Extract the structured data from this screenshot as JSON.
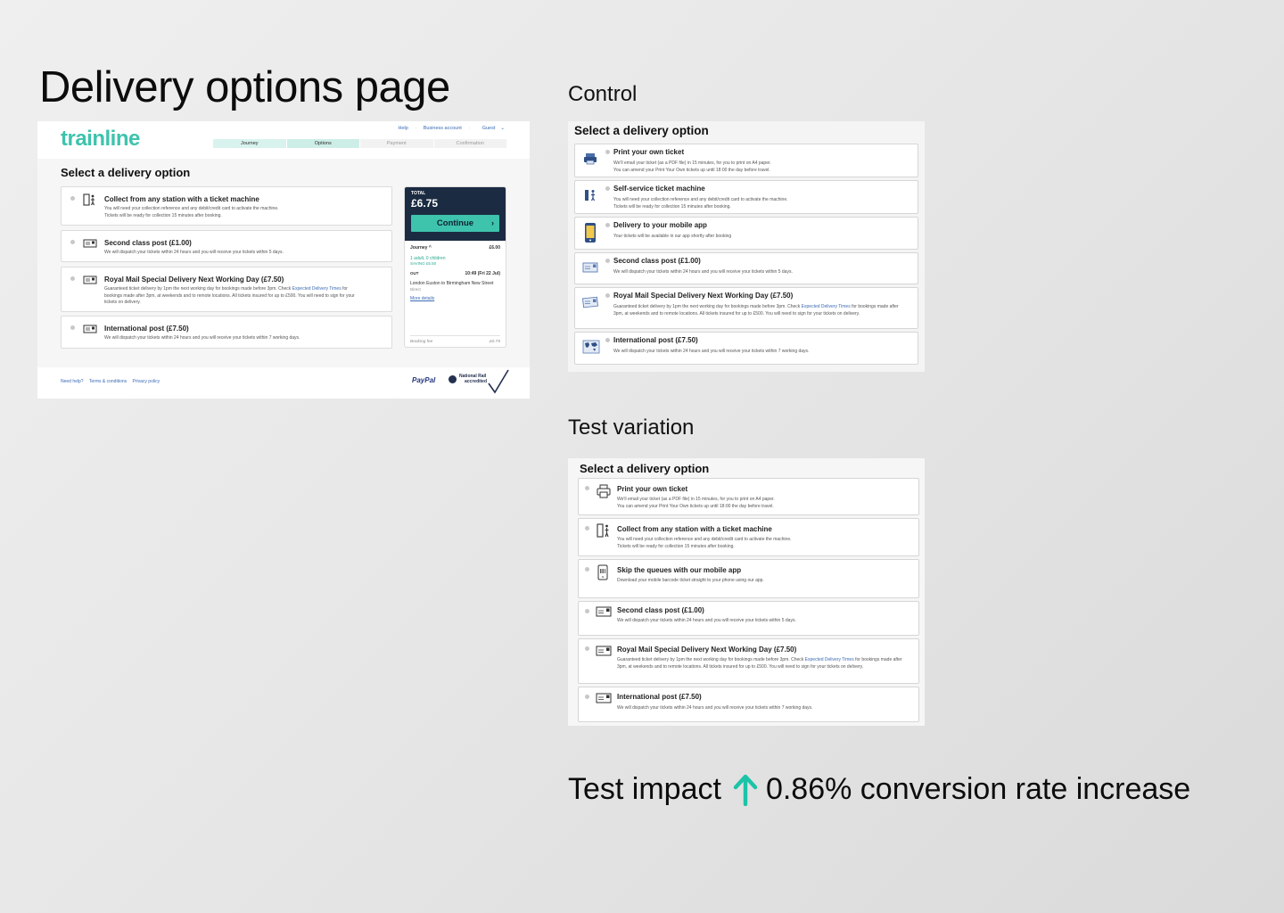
{
  "page_title": "Delivery options page",
  "main_screenshot": {
    "logo": "trainline",
    "top_links": [
      "Help",
      "Business account",
      "Guest"
    ],
    "steps": [
      "Journey",
      "Options",
      "Payment",
      "Confirmation"
    ],
    "heading": "Select a delivery option",
    "options": [
      {
        "title": "Collect from any station with a ticket machine",
        "desc": "You will need your collection reference and any debit/credit card to activate the machine.",
        "desc2": "Tickets will be ready for collection 15 minutes after booking."
      },
      {
        "title": "Second class post (£1.00)",
        "desc": "We will dispatch your tickets within 24 hours and you will receive your tickets within 5 days."
      },
      {
        "title": "Royal Mail Special Delivery Next Working Day (£7.50)",
        "desc_a": "Guaranteed ticket delivery by 1pm the next working day for bookings made before 3pm. Check ",
        "desc_link": "Expected Delivery Times",
        "desc_b": " for bookings made after 3pm, at weekends and to remote locations. All tickets insured for up to £500. You will need to sign for your tickets on delivery."
      },
      {
        "title": "International post (£7.50)",
        "desc": "We will dispatch your tickets within 24 hours and you will receive your tickets within 7 working days."
      }
    ],
    "summary": {
      "total_label": "TOTAL",
      "total": "£6.75",
      "continue": "Continue",
      "journey_label": "Journey",
      "journey_price": "£6.00",
      "passengers": "1 adult, 0 children",
      "saving": "SAVING £5.50",
      "out_label": "OUT",
      "out_time": "10:49 (Fri 22 Jul)",
      "route": "London Euston to Birmingham New Street",
      "direct": "Direct",
      "more_details": "More details",
      "booking_fee_label": "Booking fee",
      "booking_fee": "£0.75"
    },
    "footer_links": [
      "Need help?",
      "Terms & conditions",
      "Privacy policy"
    ],
    "paypal": "PayPal",
    "national_rail": [
      "National Rail",
      "accredited"
    ]
  },
  "control": {
    "label": "Control",
    "heading": "Select a delivery option",
    "options": [
      {
        "title": "Print your own ticket",
        "desc": "We'll email your ticket (as a PDF file) in 15 minutes, for you to print on A4 paper.",
        "desc2": "You can amend your Print Your Own tickets up until 18:00 the day before travel."
      },
      {
        "title": "Self-service ticket machine",
        "desc": "You will need your collection reference and any debit/credit card to activate the machine.",
        "desc2": "Tickets will be ready for collection 15 minutes after booking."
      },
      {
        "title": "Delivery to your mobile app",
        "desc": "Your tickets will be available in our app shortly after booking"
      },
      {
        "title": "Second class post (£1.00)",
        "desc": "We will dispatch your tickets within 24 hours and you will receive your tickets within 5 days."
      },
      {
        "title": "Royal Mail Special Delivery Next Working Day (£7.50)",
        "desc_a": "Guaranteed ticket delivery by 1pm the next working day for bookings made before 3pm. Check ",
        "desc_link": "Expected Delivery Times",
        "desc_b": " for bookings made after 3pm, at weekends and to remote locations. All tickets insured for up to £500. You will need to sign for your tickets on delivery."
      },
      {
        "title": "International post (£7.50)",
        "desc": "We will dispatch your tickets within 24 hours and you will receive your tickets within 7 working days."
      }
    ]
  },
  "variation": {
    "label": "Test variation",
    "heading": "Select a delivery option",
    "options": [
      {
        "title": "Print your own ticket",
        "desc": "We'll email your ticket (as a PDF file) in 15 minutes, for you to print on A4 paper.",
        "desc2": "You can amend your Print Your Own tickets up until 18:00 the day before travel."
      },
      {
        "title": "Collect from any station with a ticket machine",
        "desc": "You will need your collection reference and any debit/credit card to activate the machine.",
        "desc2": "Tickets will be ready for collection 15 minutes after booking."
      },
      {
        "title": "Skip the queues with our mobile app",
        "desc": "Download your mobile barcode ticket straight to your phone using our app."
      },
      {
        "title": "Second class post (£1.00)",
        "desc": "We will dispatch your tickets within 24 hours and you will receive your tickets within 5 days."
      },
      {
        "title": "Royal Mail Special Delivery Next Working Day (£7.50)",
        "desc_a": "Guaranteed ticket delivery by 1pm the next working day for bookings made before 3pm. Check ",
        "desc_link": "Expected Delivery Times",
        "desc_b": " for bookings made after 3pm, at weekends and to remote locations. All tickets insured for up to £500. You will need to sign for your tickets on delivery."
      },
      {
        "title": "International post (£7.50)",
        "desc": "We will dispatch your tickets within 24 hours and you will receive your tickets within 7 working days."
      }
    ]
  },
  "impact": {
    "prefix": "Test impact",
    "value": "0.86% conversion rate increase",
    "arrow_color": "#1cc3a8"
  },
  "colors": {
    "brand_teal": "#3ec3ad",
    "summary_navy": "#1b2b42",
    "link_blue": "#3b6bb5"
  }
}
